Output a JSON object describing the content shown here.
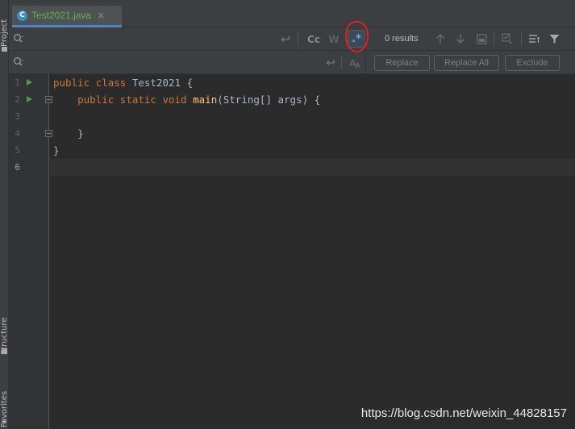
{
  "sidebar": {
    "project_label": "Project",
    "structure_label": "Structure",
    "favorites_label": "Favorites"
  },
  "editor_tab": {
    "filename": "Test2021.java",
    "icon": "java-class-icon",
    "close_glyph": "×"
  },
  "find": {
    "search_value": "",
    "replace_value": "",
    "case_label": "Cc",
    "word_label": "W",
    "regex_label": ".*",
    "results": "0 results",
    "replace_button": "Replace",
    "replace_all_button": "Replace All",
    "exclude_button": "Exclude"
  },
  "code": {
    "lines": [
      {
        "num": "1",
        "text": ""
      },
      {
        "num": "2",
        "text": ""
      },
      {
        "num": "3",
        "text": ""
      },
      {
        "num": "4",
        "text": "    }"
      },
      {
        "num": "5",
        "text": "}"
      },
      {
        "num": "6",
        "text": ""
      }
    ],
    "line1": {
      "kw1": "public",
      "kw2": "class",
      "name": " Test2021 {"
    },
    "line2": {
      "kw1": "public",
      "kw2": "static",
      "kw3": "void",
      "fn": "main",
      "rest": "(String[] args) {"
    }
  },
  "watermark": "https://blog.csdn.net/weixin_44828157",
  "colors": {
    "background": "#2b2b2b",
    "keyword": "#cc7832",
    "function": "#ffc66d",
    "tab_text": "#62b543",
    "highlight": "#e02020"
  }
}
